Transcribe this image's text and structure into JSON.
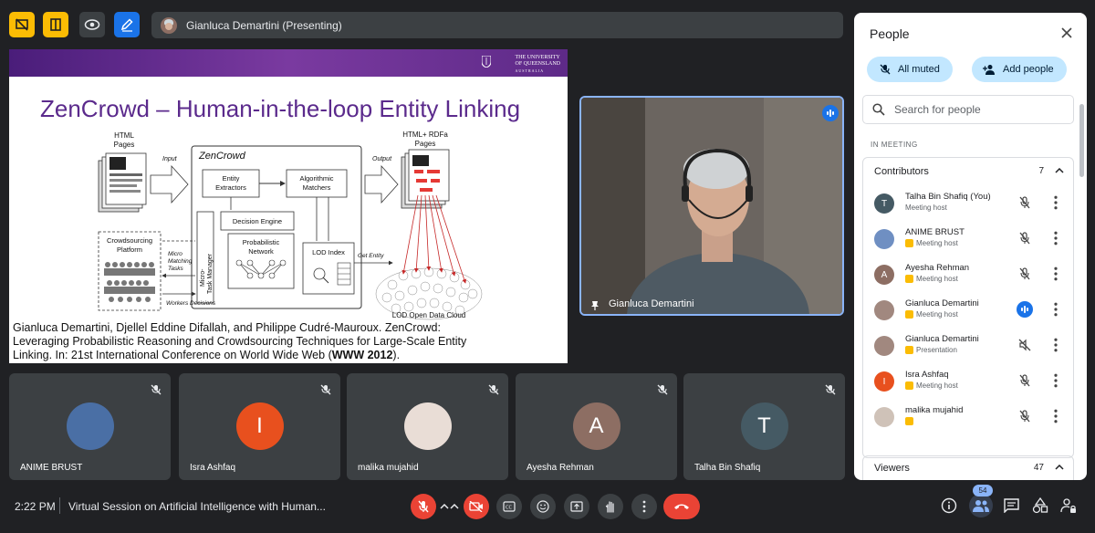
{
  "top_bar": {
    "presenter_label": "Gianluca Demartini (Presenting)"
  },
  "slide": {
    "university": [
      "THE UNIVERSITY",
      "OF QUEENSLAND",
      "AUSTRALIA"
    ],
    "title": "ZenCrowd – Human-in-the-loop Entity Linking",
    "diagram": {
      "html_pages": "HTML\nPages",
      "input": "Input",
      "zencrowd": "ZenCrowd",
      "entity_extractors": "Entity\nExtractors",
      "algorithmic_matchers": "Algorithmic\nMatchers",
      "output": "Output",
      "html_rdfa_pages": "HTML+ RDFa\nPages",
      "micro_task_manager": "Micro-\nTask Manager",
      "decision_engine": "Decision Engine",
      "probabilistic_network": "Probabilistic\nNetwork",
      "lod_index": "LOD Index",
      "get_entity": "Get Entity",
      "crowdsourcing_platform": "Crowdsourcing\nPlatform",
      "micro_matching_tasks": "Micro\nMatching\nTasks",
      "workers_decisions": "Workers Decisions",
      "lod_open_data_cloud": "LOD Open Data Cloud"
    },
    "citation_part1": "Gianluca Demartini, Djellel Eddine Difallah, and Philippe Cudré-Mauroux. ZenCrowd: Leveraging Probabilistic Reasoning and Crowdsourcing Techniques for Large-Scale Entity Linking. In: 21st International Conference on World Wide Web (",
    "citation_bold": "WWW 2012",
    "citation_part2": ")."
  },
  "main_video": {
    "name": "Gianluca Demartini"
  },
  "tiles": [
    {
      "name": "ANIME BRUST",
      "initial": "",
      "color": "#4a6fa5"
    },
    {
      "name": "Isra Ashfaq",
      "initial": "I",
      "color": "#e8501e"
    },
    {
      "name": "malika mujahid",
      "initial": "",
      "color": "#e9ddd6"
    },
    {
      "name": "Ayesha Rehman",
      "initial": "A",
      "color": "#8d6e63"
    },
    {
      "name": "Talha Bin Shafiq",
      "initial": "T",
      "color": "#455a64"
    }
  ],
  "bottom_bar": {
    "time": "2:22 PM",
    "meeting_title": "Virtual Session on Artificial Intelligence with Human...",
    "people_count": "54"
  },
  "people_panel": {
    "title": "People",
    "all_muted": "All muted",
    "add_people": "Add people",
    "search_placeholder": "Search for people",
    "in_meeting_label": "IN MEETING",
    "contributors_label": "Contributors",
    "contributors_count": "7",
    "viewers_label": "Viewers",
    "viewers_count": "47",
    "participants": [
      {
        "name": "Talha Bin Shafiq (You)",
        "role": "Meeting host",
        "initial": "T",
        "color": "#455a64",
        "badge": false,
        "speaking": false
      },
      {
        "name": "ANIME BRUST",
        "role": "Meeting host",
        "initial": "",
        "color": "#6f8fc2",
        "badge": true,
        "speaking": false
      },
      {
        "name": "Ayesha Rehman",
        "role": "Meeting host",
        "initial": "A",
        "color": "#8d6e63",
        "badge": true,
        "speaking": false
      },
      {
        "name": "Gianluca Demartini",
        "role": "Meeting host",
        "initial": "",
        "color": "#a1887f",
        "badge": true,
        "speaking": true
      },
      {
        "name": "Gianluca Demartini",
        "role": "Presentation",
        "initial": "",
        "color": "#a1887f",
        "badge": true,
        "speaking": false
      },
      {
        "name": "Isra Ashfaq",
        "role": "Meeting host",
        "initial": "I",
        "color": "#e8501e",
        "badge": true,
        "speaking": false
      },
      {
        "name": "malika mujahid",
        "role": "",
        "initial": "",
        "color": "#cfc2b8",
        "badge": true,
        "speaking": false
      }
    ]
  },
  "colors": {
    "background": "#202124",
    "accent_blue": "#1a73e8",
    "host_badge": "#fbbc04",
    "leave_red": "#ea4335",
    "slide_title": "#5b2a8c"
  }
}
